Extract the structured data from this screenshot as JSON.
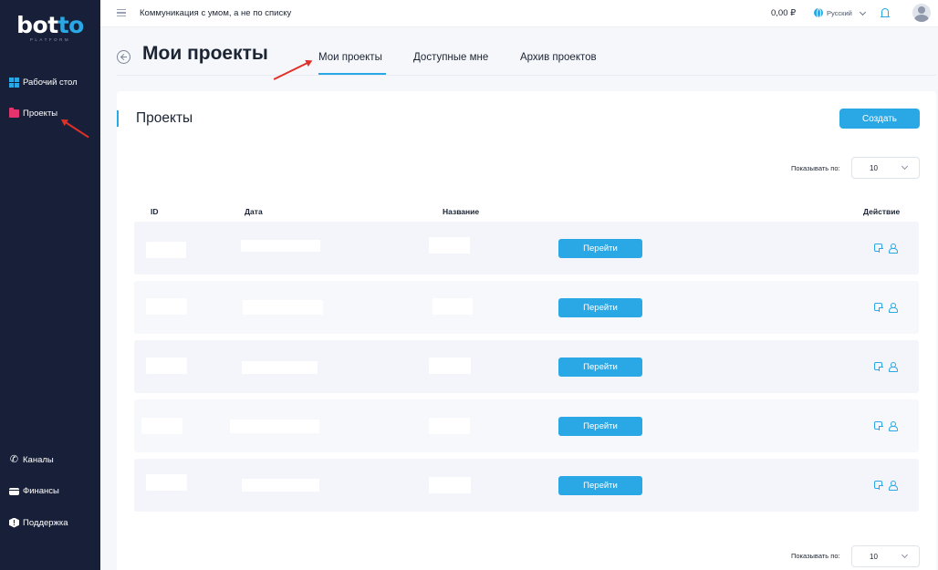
{
  "brand": {
    "logo_main": "bot",
    "logo_accent": "to",
    "logo_sub": "PLATFORM"
  },
  "sidebar": {
    "items": [
      {
        "label": "Рабочий стол",
        "icon": "dashboard-icon"
      },
      {
        "label": "Проекты",
        "icon": "folder-icon"
      },
      {
        "label": "Каналы",
        "icon": "phone-icon"
      },
      {
        "label": "Финансы",
        "icon": "wallet-icon"
      },
      {
        "label": "Поддержка",
        "icon": "support-icon"
      }
    ]
  },
  "topbar": {
    "slogan": "Коммуникация с умом, а не по списку",
    "balance": "0,00 ₽",
    "language": "Русский"
  },
  "header": {
    "title": "Мои проекты",
    "tabs": [
      {
        "label": "Мои проекты",
        "active": true
      },
      {
        "label": "Доступные мне",
        "active": false
      },
      {
        "label": "Архив проектов",
        "active": false
      }
    ]
  },
  "panel": {
    "title": "Проекты",
    "create_label": "Создать",
    "show_label": "Показывать по:",
    "page_size": "10",
    "columns": {
      "id": "ID",
      "date": "Дата",
      "name": "Название",
      "action": "Действие"
    },
    "go_label": "Перейти",
    "row_count": 5
  },
  "colors": {
    "accent": "#2aa8e6",
    "sidebar_bg": "#182039",
    "annotation": "#e0302a",
    "folder": "#e5336e"
  }
}
